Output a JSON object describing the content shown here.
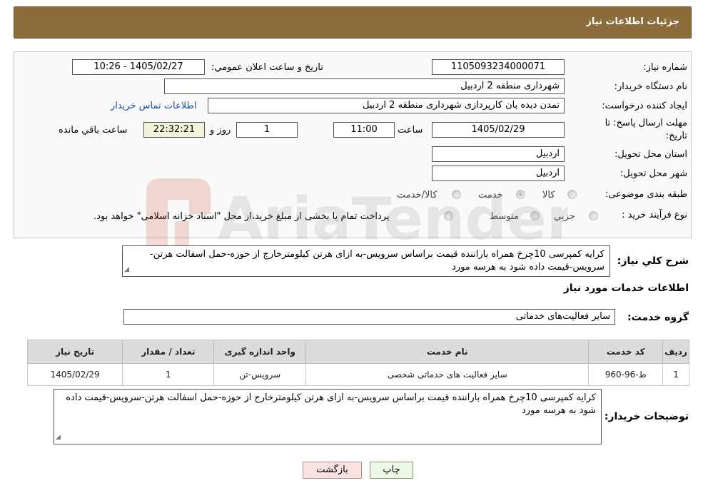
{
  "header": {
    "title": "جزئیات اطلاعات نیاز"
  },
  "fields": {
    "need_number_label": "شماره نیاز:",
    "need_number": "1105093234000071",
    "announce_label": "تاریخ و ساعت اعلان عمومي:",
    "announce_value": "1405/02/27 - 10:26",
    "buyer_org_label": "نام دستگاه خريدار:",
    "buyer_org": "شهرداری منطقه 2 اردبیل",
    "creator_label": "ايجاد کننده درخواست:",
    "creator": "تمدن دیده بان کارپردازی شهرداری منطقه 2 اردبیل",
    "contact_link": "اطلاعات تماس خريدار",
    "deadline_label": "مهلت ارسال پاسخ: تا تاریخ:",
    "deadline_date": "1405/02/29",
    "time_label": "ساعت",
    "deadline_time": "11:00",
    "days_value": "1",
    "days_label": "روز و",
    "remaining_time": "22:32:21",
    "remaining_label": "ساعت باقي مانده",
    "province_label": "استان محل تحویل:",
    "province": "اردبیل",
    "city_label": "شهر محل تحویل:",
    "city": "اردبیل",
    "category_label": "طبقه بندی موضوعی:",
    "category_options": [
      "کالا",
      "خدمت",
      "کالا/خدمت"
    ],
    "category_selected": "خدمت",
    "process_label": "نوع فرآيند خريد :",
    "process_options": [
      "جزيي",
      "متوسط"
    ],
    "process_note": "پرداخت تمام يا بخشی از مبلغ خريد،از محل \"اسناد خزانه اسلامی\" خواهد بود."
  },
  "summary": {
    "label": "شرح کلي نياز:",
    "text": "کرایه کمپرسی 10چرخ همراه باراننده قیمت براساس سرویس-به ازای هرتن کیلومترخارج از حوزه-حمل اسفالت هرتن-سرویس-قیمت داده شود به هرسه مورد"
  },
  "services_section": {
    "title": "اطلاعات خدمات مورد نياز",
    "group_label": "گروه خدمت:",
    "group_value": "سایر فعالیت‌های خدماتی"
  },
  "table": {
    "headers": [
      "رديف",
      "کد خدمت",
      "نام خدمت",
      "واحد اندازه گيری",
      "تعداد / مقدار",
      "تاريخ نياز"
    ],
    "rows": [
      [
        "1",
        "ط-96-960",
        "سایر فعالیت های خدماتی شخصی",
        "سرویس-تن",
        "1",
        "1405/02/29"
      ]
    ]
  },
  "buyer_notes": {
    "label": "توضيحات خريدار:",
    "text": "کرایه کمپرسی 10چرخ همراه باراننده قیمت براساس سرویس-به ازای هرتن کیلومترخارج از حوزه-حمل اسفالت هرتن-سرویس-قیمت داده شود به هرسه مورد"
  },
  "buttons": {
    "print": "چاپ",
    "back": "بازگشت"
  },
  "watermark": {
    "text": "AriaTender.neT"
  },
  "colors": {
    "header_bg": "#8d6c3c",
    "link": "#1a4fb0"
  }
}
